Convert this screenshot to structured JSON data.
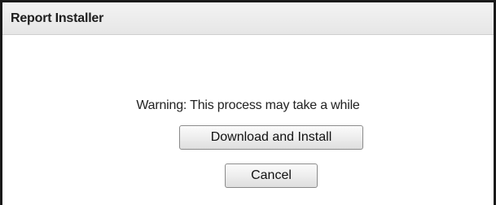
{
  "dialog": {
    "title": "Report Installer",
    "warning_text": "Warning: This process may take a while",
    "install_button_label": "Download and Install",
    "cancel_button_label": "Cancel"
  }
}
